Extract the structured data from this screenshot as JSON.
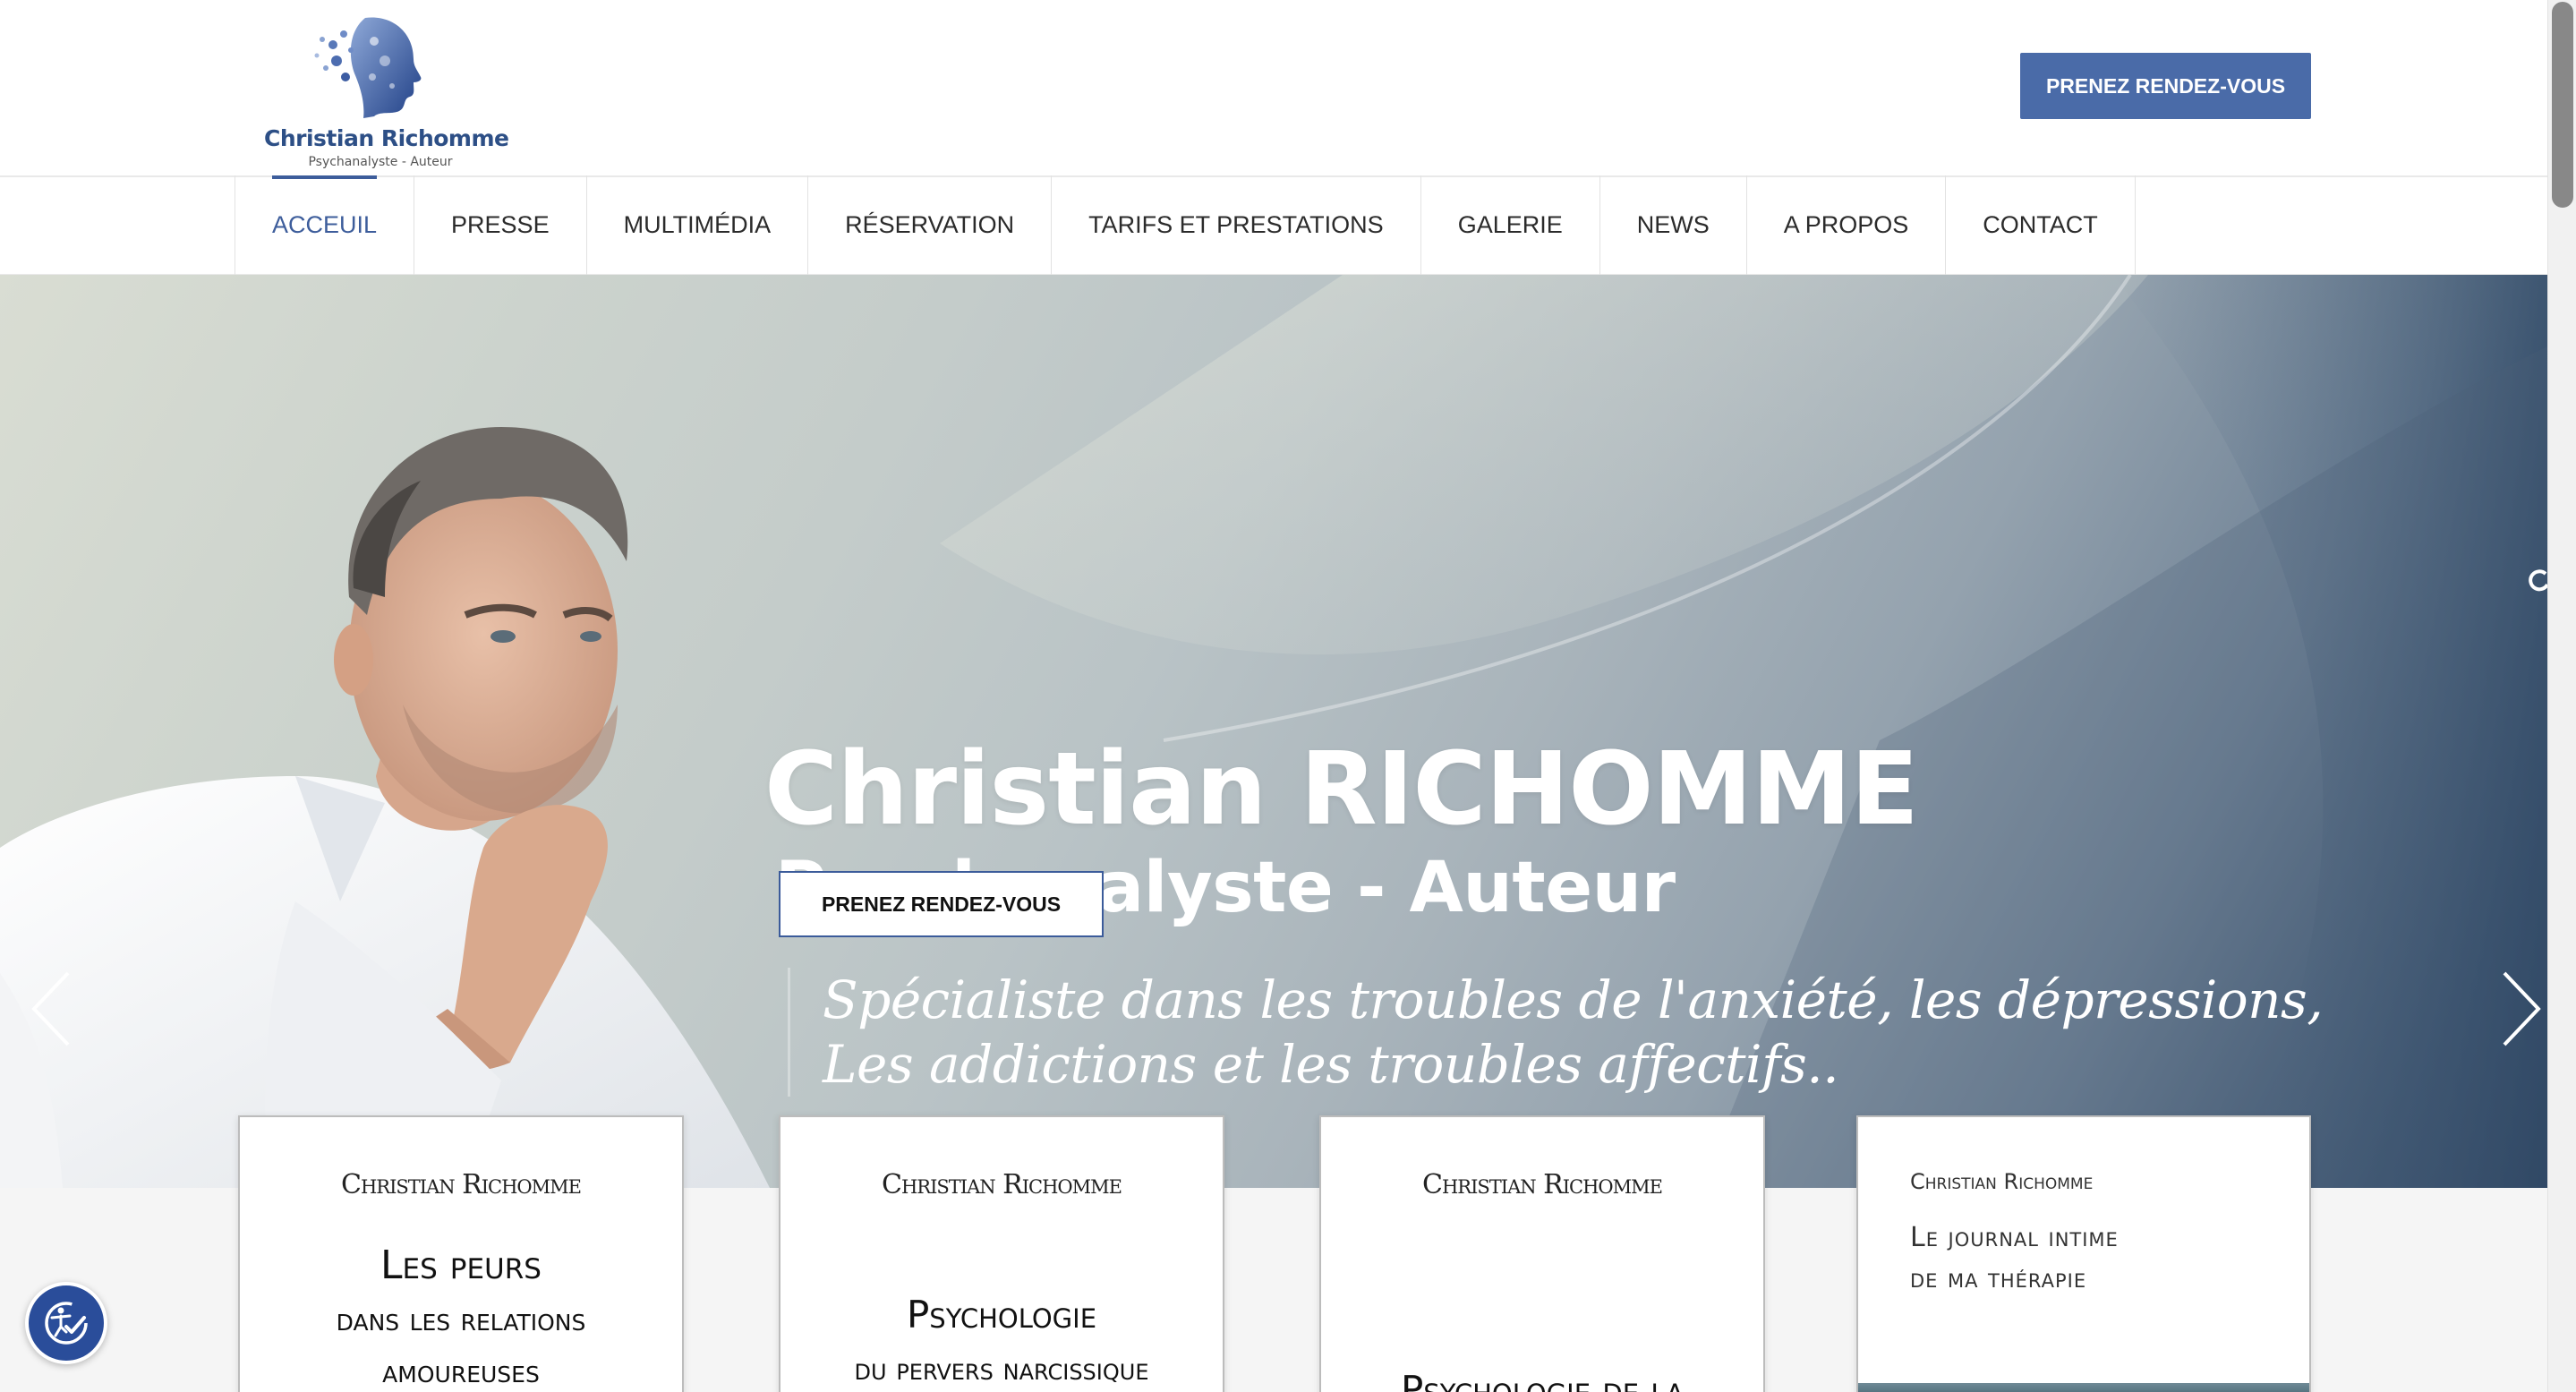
{
  "header": {
    "logo_name": "Christian Richomme",
    "logo_subtitle": "Psychanalyste - Auteur",
    "cta_label": "PRENEZ RENDEZ-VOUS"
  },
  "nav": {
    "items": [
      {
        "label": "ACCEUIL",
        "active": true
      },
      {
        "label": "PRESSE"
      },
      {
        "label": "MULTIMÉDIA"
      },
      {
        "label": "RÉSERVATION"
      },
      {
        "label": "TARIFS ET PRESTATIONS"
      },
      {
        "label": "GALERIE"
      },
      {
        "label": "NEWS"
      },
      {
        "label": "A PROPOS"
      },
      {
        "label": "CONTACT"
      }
    ]
  },
  "hero": {
    "title": "Christian RICHOMME",
    "subtitle": "Psychanalyste - Auteur",
    "quote_line1": "Spécialiste dans les troubles de l'anxiété, les dépressions,",
    "quote_line2": "Les addictions et les troubles affectifs..",
    "cta_label": "PRENEZ RENDEZ-VOUS"
  },
  "books": [
    {
      "author": "Christian Richomme",
      "title_lines": [
        "Les peurs",
        "dans les relations",
        "amoureuses"
      ]
    },
    {
      "author": "Christian Richomme",
      "title_lines": [
        "Psychologie",
        "du pervers narcissique"
      ]
    },
    {
      "author": "Christian Richomme",
      "title_lines": [
        "Psychologie de la"
      ]
    },
    {
      "author": "Christian Richomme",
      "title_lines": [
        "Le journal intime",
        "de ma thérapie"
      ]
    }
  ],
  "icons": {
    "accessibility": "accessibility-icon",
    "prev": "chevron-left-icon",
    "next": "chevron-right-icon"
  },
  "colors": {
    "brand_blue": "#4a6ba8",
    "nav_active": "#3d5d9b",
    "accessibility_bg": "#2a4d9a"
  }
}
